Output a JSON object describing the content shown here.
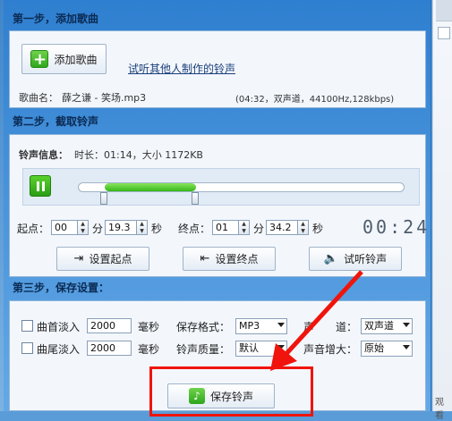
{
  "step1": {
    "title": "第一步，添加歌曲",
    "add_button": "添加歌曲",
    "link": "试听其他人制作的铃声",
    "song_label": "歌曲名：",
    "song_name": "薛之谦 - 笑场.mp3",
    "song_info": "(04:32，双声道，44100Hz,128kbps)"
  },
  "step2": {
    "title": "第二步，截取铃声",
    "ring_info_label": "铃声信息：",
    "ring_info_value": "时长：01:14，大小 1172KB",
    "progress_start": 0.08,
    "progress_end": 0.36,
    "start_label": "起点：",
    "start_min": "00",
    "min_unit": "分",
    "start_sec": "19.3",
    "sec_unit": "秒",
    "end_label": "终点：",
    "end_min": "01",
    "end_sec": "34.2",
    "clock": "00:24",
    "set_start": "设置起点",
    "set_end": "设置终点",
    "preview": "试听铃声"
  },
  "step3": {
    "title": "第三步，保存设置：",
    "fade_in_label": "曲首淡入",
    "fade_in_value": "2000",
    "fade_out_label": "曲尾淡入",
    "fade_out_value": "2000",
    "ms_unit": "毫秒",
    "format_label": "保存格式：",
    "format_value": "MP3",
    "quality_label": "铃声质量：",
    "quality_value": "默认",
    "channel_label": "声　　道：",
    "channel_value": "双声道",
    "gain_label": "声音增大：",
    "gain_value": "原始",
    "save_button": "保存铃声"
  },
  "side": {
    "text": "观看"
  },
  "colors": {
    "highlight": "#f0140c",
    "progress": "#3ec41a"
  }
}
